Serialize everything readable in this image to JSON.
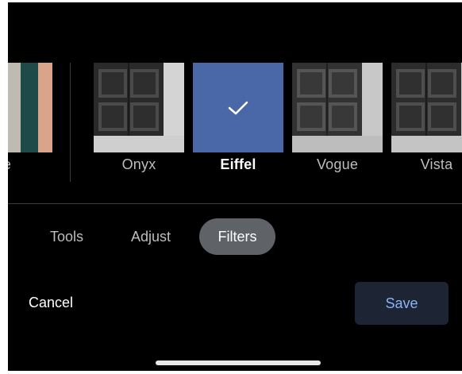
{
  "filters": [
    {
      "label": "e",
      "id": "partial"
    },
    {
      "label": "Onyx",
      "id": "onyx"
    },
    {
      "label": "Eiffel",
      "id": "eiffel",
      "selected": true
    },
    {
      "label": "Vogue",
      "id": "vogue"
    },
    {
      "label": "Vista",
      "id": "vista"
    }
  ],
  "tabs": {
    "tools": "Tools",
    "adjust": "Adjust",
    "filters": "Filters",
    "active": "filters"
  },
  "actions": {
    "cancel": "Cancel",
    "save": "Save"
  },
  "colors": {
    "background": "#000000",
    "selected_thumb": "#4a67a8",
    "active_tab": "#5f6368",
    "save_text": "#8ab4f8",
    "save_bg": "#1d2433"
  },
  "icons": {
    "selected_mark": "check-icon"
  }
}
